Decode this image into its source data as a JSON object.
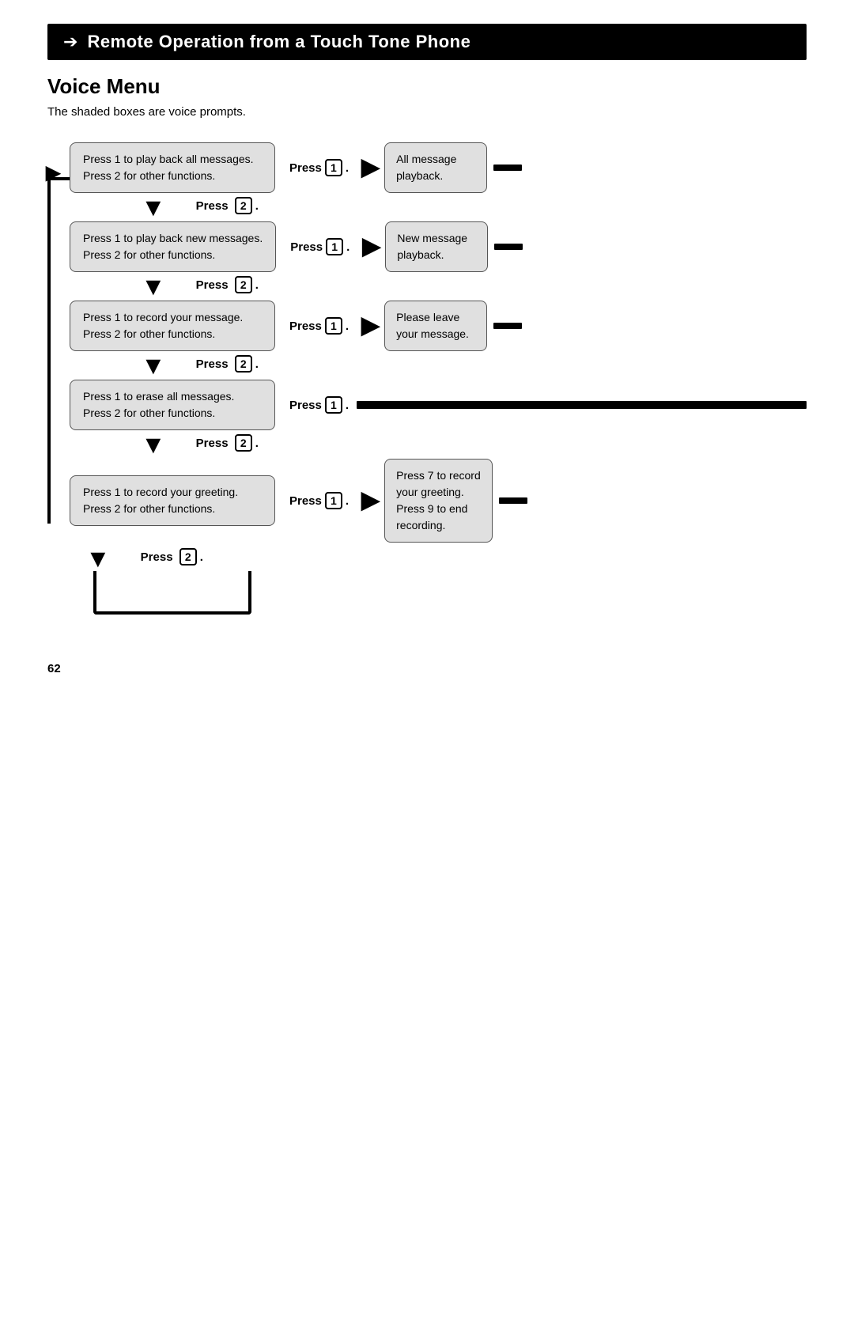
{
  "header": {
    "arrow": "➡",
    "title": "Remote Operation from a Touch Tone Phone"
  },
  "section": {
    "title": "Voice Menu",
    "subtitle": "The shaded boxes are voice prompts."
  },
  "rows": [
    {
      "id": "row1",
      "voice_box": [
        "Press 1 to play back all messages.",
        "Press 2 for other functions."
      ],
      "press_label": "Press",
      "key": "1",
      "result_text": [
        "All message",
        "playback."
      ],
      "has_result": true,
      "press2_below": true
    },
    {
      "id": "row2",
      "voice_box": [
        "Press 1 to play back new messages.",
        "Press 2 for other functions."
      ],
      "press_label": "Press",
      "key": "1",
      "result_text": [
        "New message",
        "playback."
      ],
      "has_result": true,
      "press2_below": true
    },
    {
      "id": "row3",
      "voice_box": [
        "Press 1 to record your message.",
        "Press 2 for other functions."
      ],
      "press_label": "Press",
      "key": "1",
      "result_text": [
        "Please leave",
        "your message."
      ],
      "has_result": true,
      "press2_below": true
    },
    {
      "id": "row4",
      "voice_box": [
        "Press 1 to erase all messages.",
        "Press 2 for other functions."
      ],
      "press_label": "Press",
      "key": "1",
      "result_text": [],
      "has_result": false,
      "press2_below": true
    },
    {
      "id": "row5",
      "voice_box": [
        "Press 1 to record your greeting.",
        "Press 2 for other functions."
      ],
      "press_label": "Press",
      "key": "1",
      "result_text": [
        "Press 7 to record",
        "your greeting.",
        "Press 9 to end",
        "recording."
      ],
      "has_result": true,
      "press2_below": true
    }
  ],
  "press2_label": "Press",
  "press2_key": "2",
  "page_number": "62"
}
